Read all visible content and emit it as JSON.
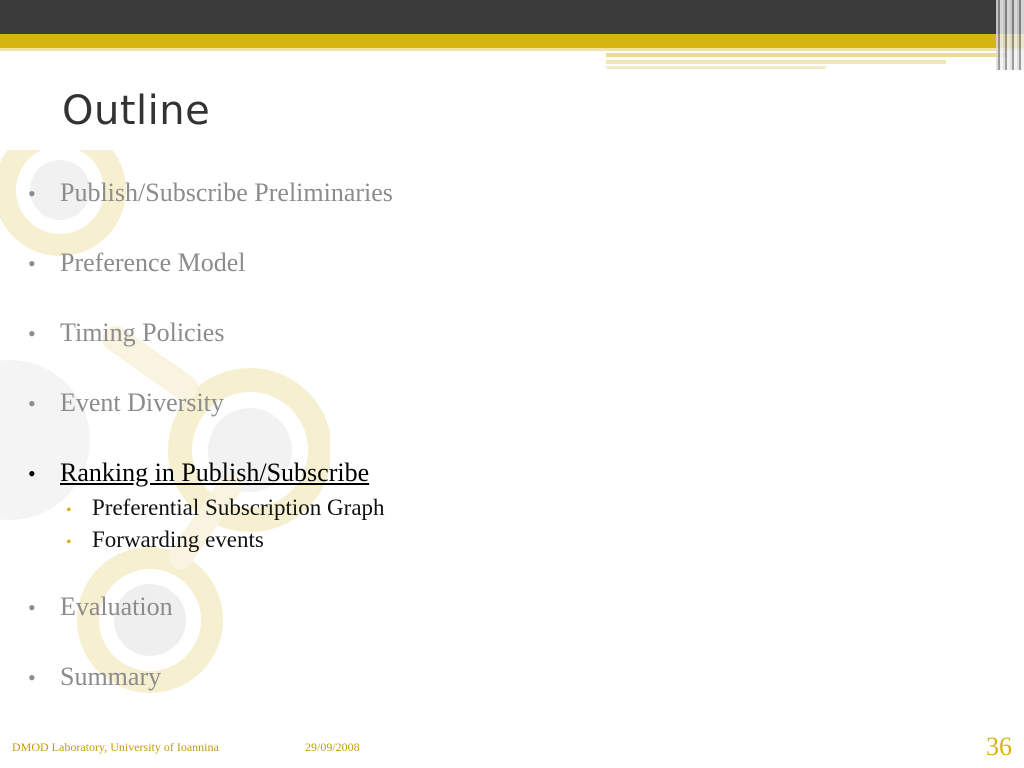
{
  "slide": {
    "title": "Outline",
    "bullets": [
      "Publish/Subscribe Preliminaries",
      "Preference Model",
      "Timing Policies",
      "Event Diversity",
      "Ranking in Publish/Subscribe",
      "Evaluation",
      "Summary"
    ],
    "subbullets": [
      "Preferential Subscription Graph",
      "Forwarding events"
    ],
    "bullet_glyph": "•"
  },
  "footer": {
    "organization": "DMOD Laboratory, University of Ioannina",
    "date": "29/09/2008",
    "page": "36"
  },
  "colors": {
    "accent": "#d6b411",
    "dark_bar": "#3b3b3b",
    "muted_text": "#8c8c8c",
    "active_text": "#000000"
  }
}
